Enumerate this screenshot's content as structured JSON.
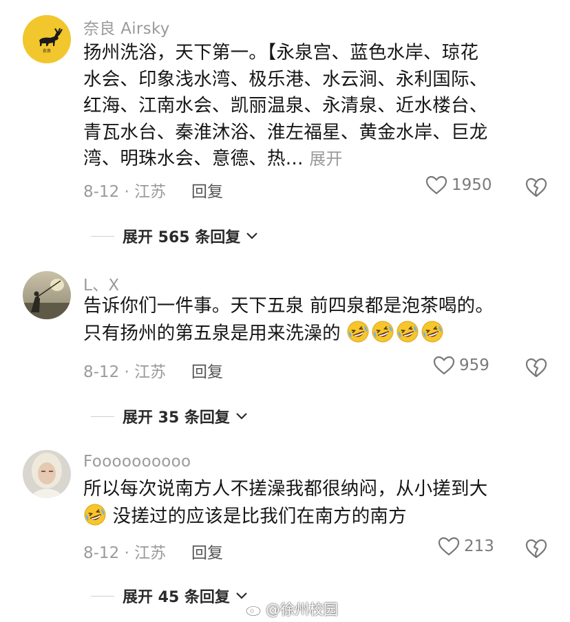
{
  "comments": [
    {
      "username": "奈良 Airsky",
      "lines": [
        "扬州洗浴，天下第一。【永泉宫、蓝色水岸、琼花",
        "水会、印象浅水湾、极乐港、水云涧、永利国际、",
        "红海、江南水会、凯丽温泉、永清泉、近水楼台、",
        "青瓦水台、秦淮沐浴、淮左福星、黄金水岸、巨龙",
        "湾、明珠水会、意德、热..."
      ],
      "expand_inline": "展开",
      "date_location": "8-12 · 江苏",
      "reply_label": "回复",
      "likes": "1950",
      "expand_replies": "展开 565 条回复"
    },
    {
      "username": "L、X",
      "lines": [
        "告诉你们一件事。天下五泉 前四泉都是泡茶喝的。",
        "只有扬州的第五泉是用来洗澡的"
      ],
      "emoji_count": 4,
      "date_location": "8-12 · 江苏",
      "reply_label": "回复",
      "likes": "959",
      "expand_replies": "展开 35 条回复"
    },
    {
      "username": "Foooooooooo",
      "lines": [
        "所以每次说南方人不搓澡我都很纳闷，从小搓到大",
        "没搓过的应该是比我们在南方的南方"
      ],
      "date_location": "8-12 · 江苏",
      "reply_label": "回复",
      "likes": "213",
      "expand_replies": "展开 45 条回复"
    }
  ],
  "icons": {
    "like": "heart-outline-icon",
    "dislike": "broken-heart-icon",
    "expand": "chevron-down-icon",
    "emoji": "rolling-laughing-emoji"
  },
  "watermark": "@徐州校园",
  "colors": {
    "text": "#161616",
    "secondary": "#9a9a9a",
    "emoji": "#f7c52c"
  }
}
